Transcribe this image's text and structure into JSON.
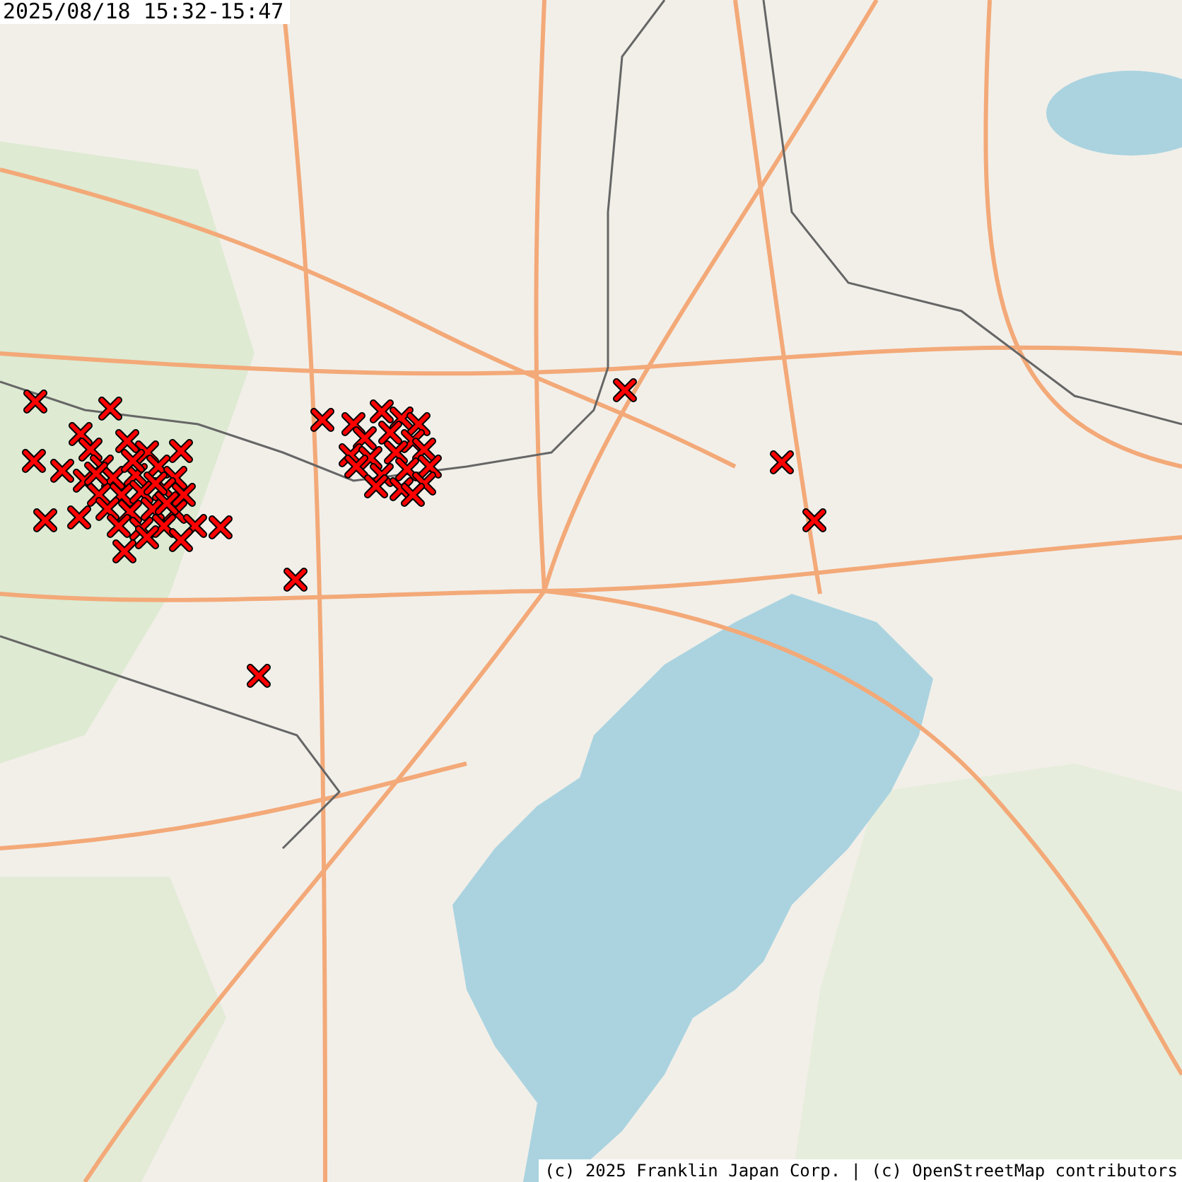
{
  "title": "2025/08/18 15:32-15:47",
  "attribution": "(c) 2025 Franklin Japan Corp. | (c) OpenStreetMap contributors"
}
